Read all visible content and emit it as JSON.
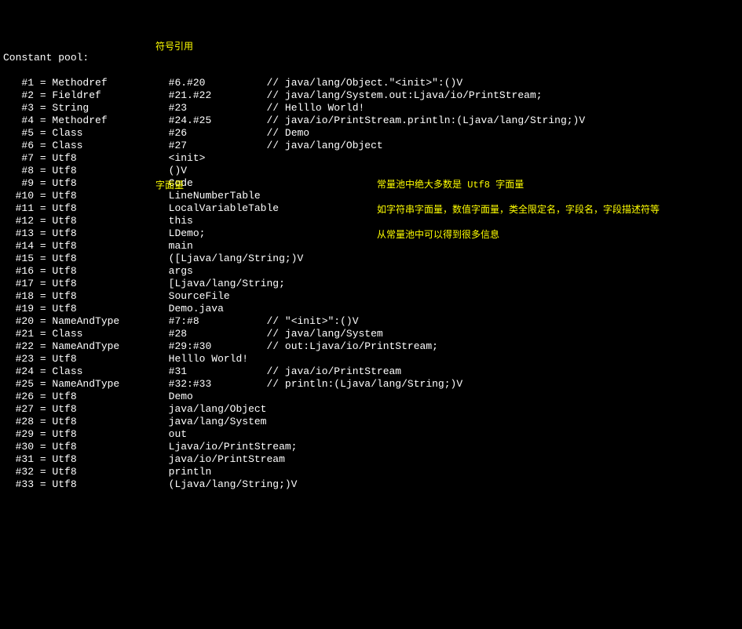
{
  "header": "Constant pool:",
  "annotations": {
    "symbol_ref": "符号引用",
    "literal": "字面量",
    "note1": "常量池中绝大多数是 Utf8 字面量",
    "note2": "如字符串字面量，数值字面量，类全限定名，字段名，字段描述符等",
    "note3": "从常量池中可以得到很多信息"
  },
  "entries": [
    {
      "idx": "   #1",
      "type": "Methodref",
      "value": "#6.#20",
      "comment": "// java/lang/Object.\"<init>\":()V"
    },
    {
      "idx": "   #2",
      "type": "Fieldref",
      "value": "#21.#22",
      "comment": "// java/lang/System.out:Ljava/io/PrintStream;"
    },
    {
      "idx": "   #3",
      "type": "String",
      "value": "#23",
      "comment": "// Helllo World!"
    },
    {
      "idx": "   #4",
      "type": "Methodref",
      "value": "#24.#25",
      "comment": "// java/io/PrintStream.println:(Ljava/lang/String;)V"
    },
    {
      "idx": "   #5",
      "type": "Class",
      "value": "#26",
      "comment": "// Demo"
    },
    {
      "idx": "   #6",
      "type": "Class",
      "value": "#27",
      "comment": "// java/lang/Object"
    },
    {
      "idx": "   #7",
      "type": "Utf8",
      "value": "<init>",
      "comment": ""
    },
    {
      "idx": "   #8",
      "type": "Utf8",
      "value": "()V",
      "comment": ""
    },
    {
      "idx": "   #9",
      "type": "Utf8",
      "value": "Code",
      "comment": ""
    },
    {
      "idx": "  #10",
      "type": "Utf8",
      "value": "LineNumberTable",
      "comment": ""
    },
    {
      "idx": "  #11",
      "type": "Utf8",
      "value": "LocalVariableTable",
      "comment": ""
    },
    {
      "idx": "  #12",
      "type": "Utf8",
      "value": "this",
      "comment": ""
    },
    {
      "idx": "  #13",
      "type": "Utf8",
      "value": "LDemo;",
      "comment": ""
    },
    {
      "idx": "  #14",
      "type": "Utf8",
      "value": "main",
      "comment": ""
    },
    {
      "idx": "  #15",
      "type": "Utf8",
      "value": "([Ljava/lang/String;)V",
      "comment": ""
    },
    {
      "idx": "  #16",
      "type": "Utf8",
      "value": "args",
      "comment": ""
    },
    {
      "idx": "  #17",
      "type": "Utf8",
      "value": "[Ljava/lang/String;",
      "comment": ""
    },
    {
      "idx": "  #18",
      "type": "Utf8",
      "value": "SourceFile",
      "comment": ""
    },
    {
      "idx": "  #19",
      "type": "Utf8",
      "value": "Demo.java",
      "comment": ""
    },
    {
      "idx": "  #20",
      "type": "NameAndType",
      "value": "#7:#8",
      "comment": "// \"<init>\":()V"
    },
    {
      "idx": "  #21",
      "type": "Class",
      "value": "#28",
      "comment": "// java/lang/System"
    },
    {
      "idx": "  #22",
      "type": "NameAndType",
      "value": "#29:#30",
      "comment": "// out:Ljava/io/PrintStream;"
    },
    {
      "idx": "  #23",
      "type": "Utf8",
      "value": "Helllo World!",
      "comment": ""
    },
    {
      "idx": "  #24",
      "type": "Class",
      "value": "#31",
      "comment": "// java/io/PrintStream"
    },
    {
      "idx": "  #25",
      "type": "NameAndType",
      "value": "#32:#33",
      "comment": "// println:(Ljava/lang/String;)V"
    },
    {
      "idx": "  #26",
      "type": "Utf8",
      "value": "Demo",
      "comment": ""
    },
    {
      "idx": "  #27",
      "type": "Utf8",
      "value": "java/lang/Object",
      "comment": ""
    },
    {
      "idx": "  #28",
      "type": "Utf8",
      "value": "java/lang/System",
      "comment": ""
    },
    {
      "idx": "  #29",
      "type": "Utf8",
      "value": "out",
      "comment": ""
    },
    {
      "idx": "  #30",
      "type": "Utf8",
      "value": "Ljava/io/PrintStream;",
      "comment": ""
    },
    {
      "idx": "  #31",
      "type": "Utf8",
      "value": "java/io/PrintStream",
      "comment": ""
    },
    {
      "idx": "  #32",
      "type": "Utf8",
      "value": "println",
      "comment": ""
    },
    {
      "idx": "  #33",
      "type": "Utf8",
      "value": "(Ljava/lang/String;)V",
      "comment": ""
    }
  ]
}
